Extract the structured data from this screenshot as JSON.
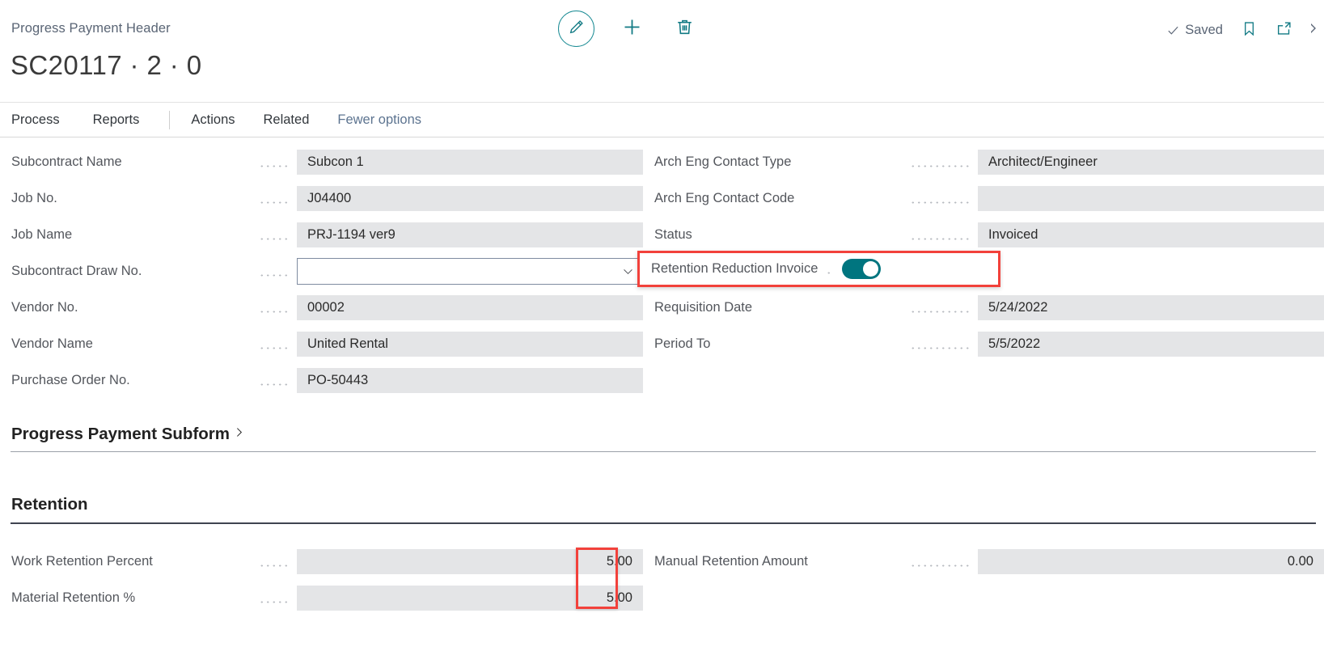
{
  "window": {
    "breadcrumb": "Progress Payment Header",
    "title": "SC20117 · 2 · 0"
  },
  "toolbar": {
    "edit_icon": "pencil-icon",
    "new_icon": "plus-icon",
    "delete_icon": "trash-icon",
    "saved_label": "Saved",
    "saved_icon": "checkmark-icon",
    "bookmark_icon": "bookmark-icon",
    "open_new_window_icon": "open-in-new-window-icon"
  },
  "nav": {
    "items": [
      {
        "label": "Process",
        "muted": false
      },
      {
        "label": "Reports",
        "muted": false
      },
      {
        "label": "Actions",
        "muted": false
      },
      {
        "label": "Related",
        "muted": false
      },
      {
        "label": "Fewer options",
        "muted": true
      }
    ]
  },
  "general": {
    "left": [
      {
        "label": "Subcontract Name",
        "value": "Subcon 1",
        "type": "readonly"
      },
      {
        "label": "Job No.",
        "value": "J04400",
        "type": "readonly"
      },
      {
        "label": "Job Name",
        "value": "PRJ-1194 ver9",
        "type": "readonly"
      },
      {
        "label": "Subcontract Draw No.",
        "value": "",
        "type": "dropdown"
      },
      {
        "label": "Vendor No.",
        "value": "00002",
        "type": "readonly"
      },
      {
        "label": "Vendor Name",
        "value": "United Rental",
        "type": "readonly"
      },
      {
        "label": "Purchase Order No.",
        "value": "PO-50443",
        "type": "readonly"
      }
    ],
    "right": [
      {
        "label": "Arch Eng Contact Type",
        "value": "Architect/Engineer",
        "type": "readonly"
      },
      {
        "label": "Arch Eng Contact Code",
        "value": "",
        "type": "readonly"
      },
      {
        "label": "Status",
        "value": "Invoiced",
        "type": "readonly"
      },
      {
        "label": "Retention Reduction Invoice",
        "value": "on",
        "type": "toggle"
      },
      {
        "label": "Requisition Date",
        "value": "5/24/2022",
        "type": "readonly"
      },
      {
        "label": "Period To",
        "value": "5/5/2022",
        "type": "readonly"
      }
    ]
  },
  "subform": {
    "title": "Progress Payment Subform",
    "chevron_icon": "chevron-right-icon"
  },
  "retention": {
    "title": "Retention",
    "left": [
      {
        "label": "Work Retention Percent",
        "value": "5.00"
      },
      {
        "label": "Material Retention %",
        "value": "5.00"
      }
    ],
    "right": [
      {
        "label": "Manual Retention Amount",
        "value": "0.00"
      }
    ]
  },
  "colors": {
    "accent_teal": "#00757f",
    "annotation_red": "#f2413b",
    "field_gray": "#e4e5e7"
  }
}
